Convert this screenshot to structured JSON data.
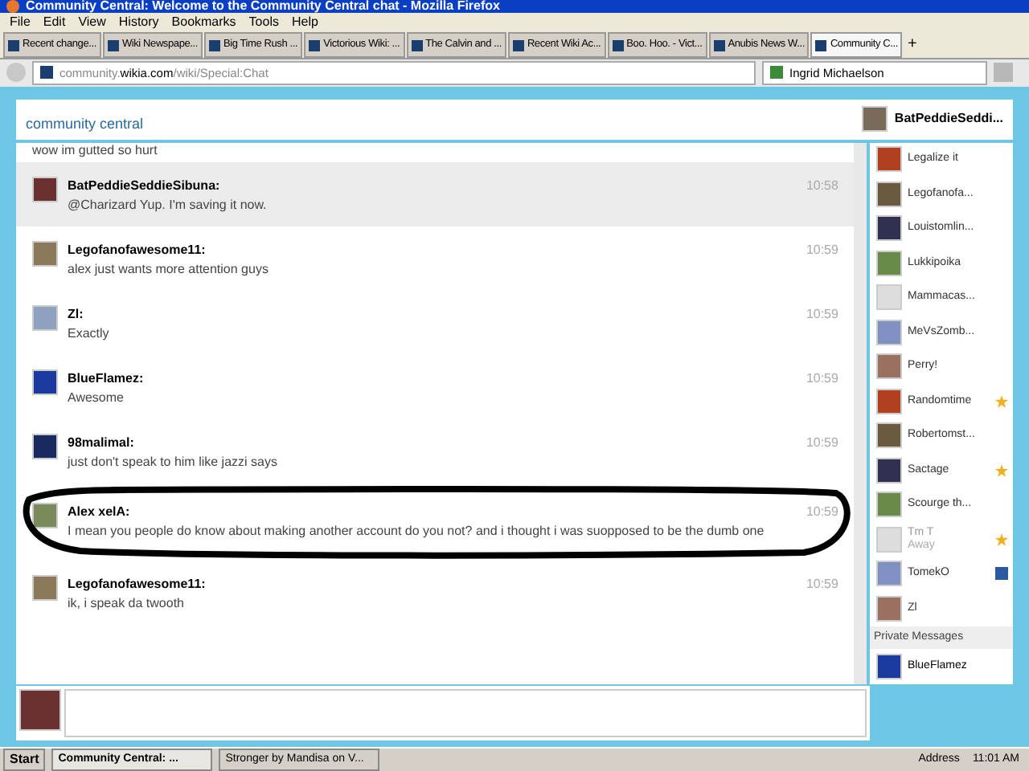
{
  "window": {
    "title": "Community Central: Welcome to the Community Central chat - Mozilla Firefox"
  },
  "menu": [
    "File",
    "Edit",
    "View",
    "History",
    "Bookmarks",
    "Tools",
    "Help"
  ],
  "tabs": [
    {
      "label": "Recent change...",
      "selected": false
    },
    {
      "label": "Wiki Newspape...",
      "selected": false
    },
    {
      "label": "Big Time Rush ...",
      "selected": false
    },
    {
      "label": "Victorious Wiki: ...",
      "selected": false
    },
    {
      "label": "The Calvin and ...",
      "selected": false
    },
    {
      "label": "Recent Wiki Ac...",
      "selected": false
    },
    {
      "label": "Boo. Hoo. - Vict...",
      "selected": false
    },
    {
      "label": "Anubis News W...",
      "selected": false
    },
    {
      "label": "Community C...",
      "selected": true
    }
  ],
  "new_tab": "+",
  "address": {
    "host": "community.",
    "domain": "wikia.com",
    "path": "/wiki/Special:Chat"
  },
  "search": {
    "value": "Ingrid Michaelson"
  },
  "header": {
    "logo": "community central",
    "user": "BatPeddieSeddi..."
  },
  "messages": [
    {
      "text": "wow im gutted so hurt",
      "highlighted": false,
      "circled": false
    },
    {
      "user": "BatPeddieSeddieSibuna:",
      "text": "@Charizard Yup. I'm saving it now.",
      "time": "10:58",
      "highlighted": true,
      "circled": false
    },
    {
      "user": "Legofanofawesome11:",
      "text": "alex just wants more attention guys",
      "time": "10:59",
      "highlighted": false,
      "circled": false
    },
    {
      "user": "Zl:",
      "text": "Exactly",
      "time": "10:59",
      "highlighted": false,
      "circled": false
    },
    {
      "user": "BlueFlamez:",
      "text": "Awesome",
      "time": "10:59",
      "highlighted": false,
      "circled": false
    },
    {
      "user": "98malimal:",
      "text": "just don't speak to him like jazzi says",
      "time": "10:59",
      "highlighted": false,
      "circled": false
    },
    {
      "user": "Alex xelA:",
      "text": "I mean you people do know about making another account do you not? and i thought i was suopposed to be the dumb one",
      "time": "10:59",
      "highlighted": false,
      "circled": true
    },
    {
      "user": "Legofanofawesome11:",
      "text": "ik, i speak da twooth",
      "time": "10:59",
      "highlighted": false,
      "circled": false
    }
  ],
  "users": [
    {
      "name": "Legalize it",
      "starred": false,
      "moderator": false,
      "away": false
    },
    {
      "name": "Legofanofa...",
      "starred": false,
      "moderator": false,
      "away": false
    },
    {
      "name": "Louistomlin...",
      "starred": false,
      "moderator": false,
      "away": false
    },
    {
      "name": "Lukkipoika",
      "starred": false,
      "moderator": false,
      "away": false
    },
    {
      "name": "Mammacas...",
      "starred": false,
      "moderator": false,
      "away": false
    },
    {
      "name": "MeVsZomb...",
      "starred": false,
      "moderator": false,
      "away": false
    },
    {
      "name": "Perry!",
      "starred": false,
      "moderator": false,
      "away": false
    },
    {
      "name": "Randomtime",
      "starred": true,
      "moderator": false,
      "away": false
    },
    {
      "name": "Robertomst...",
      "starred": false,
      "moderator": false,
      "away": false
    },
    {
      "name": "Sactage",
      "starred": true,
      "moderator": false,
      "away": false
    },
    {
      "name": "Scourge th...",
      "starred": false,
      "moderator": false,
      "away": false
    },
    {
      "name": "Tm T",
      "status": "Away",
      "starred": true,
      "moderator": false,
      "away": true
    },
    {
      "name": "TomekO",
      "starred": false,
      "moderator": true,
      "away": false
    },
    {
      "name": "Zl",
      "starred": false,
      "moderator": false,
      "away": false
    }
  ],
  "private_messages": {
    "title": "Private Messages",
    "users": [
      {
        "name": "BlueFlamez"
      }
    ]
  },
  "taskbar": {
    "start": "Start",
    "tasks": [
      {
        "label": "Community Central: ...",
        "selected": true
      },
      {
        "label": "Stronger by Mandisa on V...",
        "selected": false
      }
    ],
    "address": "Address",
    "clock": "11:01 AM"
  }
}
